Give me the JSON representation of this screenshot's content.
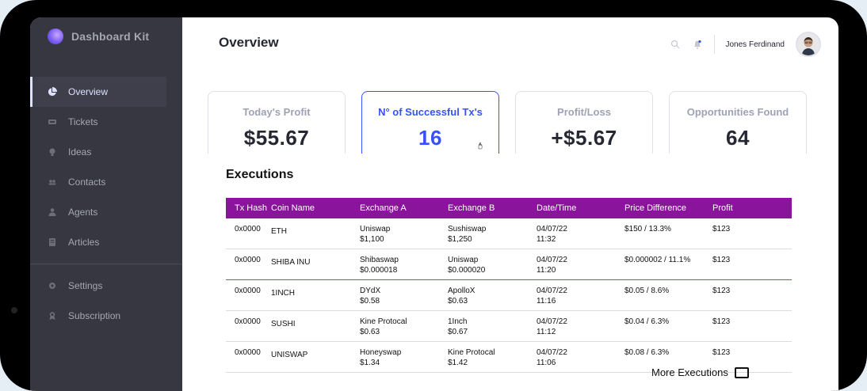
{
  "brand": {
    "name": "Dashboard Kit"
  },
  "sidebar": {
    "items": [
      {
        "label": "Overview",
        "icon": "pie-chart-icon",
        "active": true
      },
      {
        "label": "Tickets",
        "icon": "ticket-icon"
      },
      {
        "label": "Ideas",
        "icon": "lightbulb-icon"
      },
      {
        "label": "Contacts",
        "icon": "contacts-icon"
      },
      {
        "label": "Agents",
        "icon": "agent-icon"
      },
      {
        "label": "Articles",
        "icon": "article-icon"
      }
    ],
    "bottom_items": [
      {
        "label": "Settings",
        "icon": "gear-icon"
      },
      {
        "label": "Subscription",
        "icon": "award-icon"
      }
    ]
  },
  "header": {
    "title": "Overview",
    "user_name": "Jones Ferdinand"
  },
  "cards": [
    {
      "title": "Today's Profit",
      "value": "$55.67"
    },
    {
      "title": "N° of Successful Tx's",
      "value": "16",
      "selected": true
    },
    {
      "title": "Profit/Loss",
      "value": "+$5.67"
    },
    {
      "title": "Opportunities Found",
      "value": "64"
    }
  ],
  "executions": {
    "title": "Executions",
    "columns": [
      "Tx Hash",
      "Coin Name",
      "Exchange A",
      "Exchange B",
      "Date/Time",
      "Price Difference",
      "Profit"
    ],
    "rows": [
      {
        "hash": "0x0000",
        "coin": "ETH",
        "exa_name": "Uniswap",
        "exa_price": "$1,100",
        "exb_name": "Sushiswap",
        "exb_price": "$1,250",
        "date": "04/07/22",
        "time": "11:32",
        "diff": "$150  /  13.3%",
        "profit": "$123"
      },
      {
        "hash": "0x0000",
        "coin": "SHIBA INU",
        "exa_name": "Shibaswap",
        "exa_price": "$0.000018",
        "exb_name": "Uniswap",
        "exb_price": "$0.000020",
        "date": "04/07/22",
        "time": "11:20",
        "diff": "$0.000002  /  11.1%",
        "profit": "$123"
      },
      {
        "hash": "0x0000",
        "coin": "1INCH",
        "exa_name": "DYdX",
        "exa_price": "$0.58",
        "exb_name": "ApolloX",
        "exb_price": "$0.63",
        "date": "04/07/22",
        "time": "11:16",
        "diff": "$0.05  /  8.6%",
        "profit": "$123"
      },
      {
        "hash": "0x0000",
        "coin": "SUSHI",
        "exa_name": "Kine Protocal",
        "exa_price": "$0.63",
        "exb_name": "1Inch",
        "exb_price": "$0.67",
        "date": "04/07/22",
        "time": "11:12",
        "diff": "$0.04  /  6.3%",
        "profit": "$123"
      },
      {
        "hash": "0x0000",
        "coin": "UNISWAP",
        "exa_name": "Honeyswap",
        "exa_price": "$1.34",
        "exb_name": "Kine Protocal",
        "exb_price": "$1.42",
        "date": "04/07/22",
        "time": "11:06",
        "diff": "$0.08  /  6.3%",
        "profit": "$123"
      }
    ],
    "more_label": "More Executions"
  },
  "colors": {
    "sidebar_bg": "#363740",
    "accent": "#3751ff",
    "table_header": "#8a149b"
  }
}
